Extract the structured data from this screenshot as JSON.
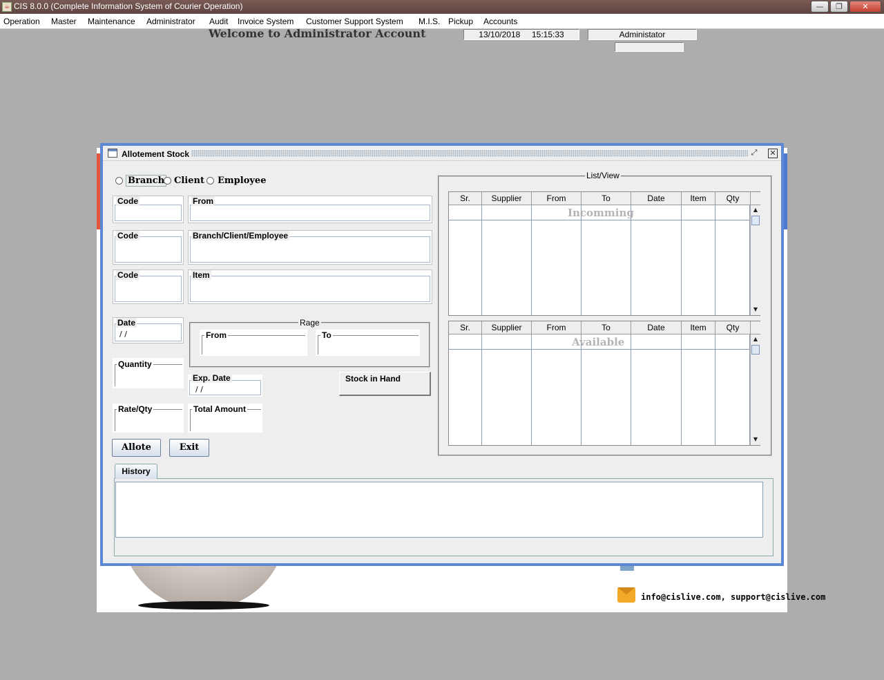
{
  "window": {
    "title": "CIS 8.0.0 (Complete Information System of Courier Operation)",
    "minimize_label": "—",
    "restore_label": "❐",
    "close_label": "✕"
  },
  "menu": [
    "Operation",
    "Master",
    "Maintenance",
    "Administrator",
    "Audit",
    "Invoice System",
    "Customer Support System",
    "M.I.S.",
    "Pickup",
    "Accounts"
  ],
  "header": {
    "welcome": "Welcome to Administrator Account",
    "date": "13/10/2018",
    "time": "15:15:33",
    "user": "Administator",
    "user_sub": ""
  },
  "background": {
    "contact": "info@cislive.com, support@cislive.com"
  },
  "frame": {
    "title": "Allotement Stock",
    "radios": [
      "Branch",
      "Client",
      "Employee"
    ],
    "selected_radio": "Branch",
    "fields": {
      "code1": "Code",
      "from": "From",
      "code2": "Code",
      "bce": "Branch/Client/Employee",
      "code3": "Code",
      "item": "Item",
      "date": "Date",
      "date_value": " / /",
      "range": "Rage",
      "range_from": "From",
      "range_to": "To",
      "quantity": "Quantity",
      "exp_date": "Exp. Date",
      "exp_date_value": " / /",
      "stock_in_hand": "Stock in Hand",
      "rate_qty": "Rate/Qty",
      "total_amount": "Total Amount"
    },
    "buttons": {
      "allote": "Allote",
      "exit": "Exit"
    },
    "list_view": {
      "title": "List/View",
      "columns": [
        "Sr.",
        "Supplier",
        "From",
        "To",
        "Date",
        "Item",
        "Qty"
      ],
      "incoming_label": "Incomming",
      "available_label": "Available"
    },
    "history": {
      "tab": "History"
    }
  },
  "colors": {
    "frame_border": "#5b87d6",
    "title_bar": "#6b4f4a",
    "desktop": "#adadad"
  }
}
